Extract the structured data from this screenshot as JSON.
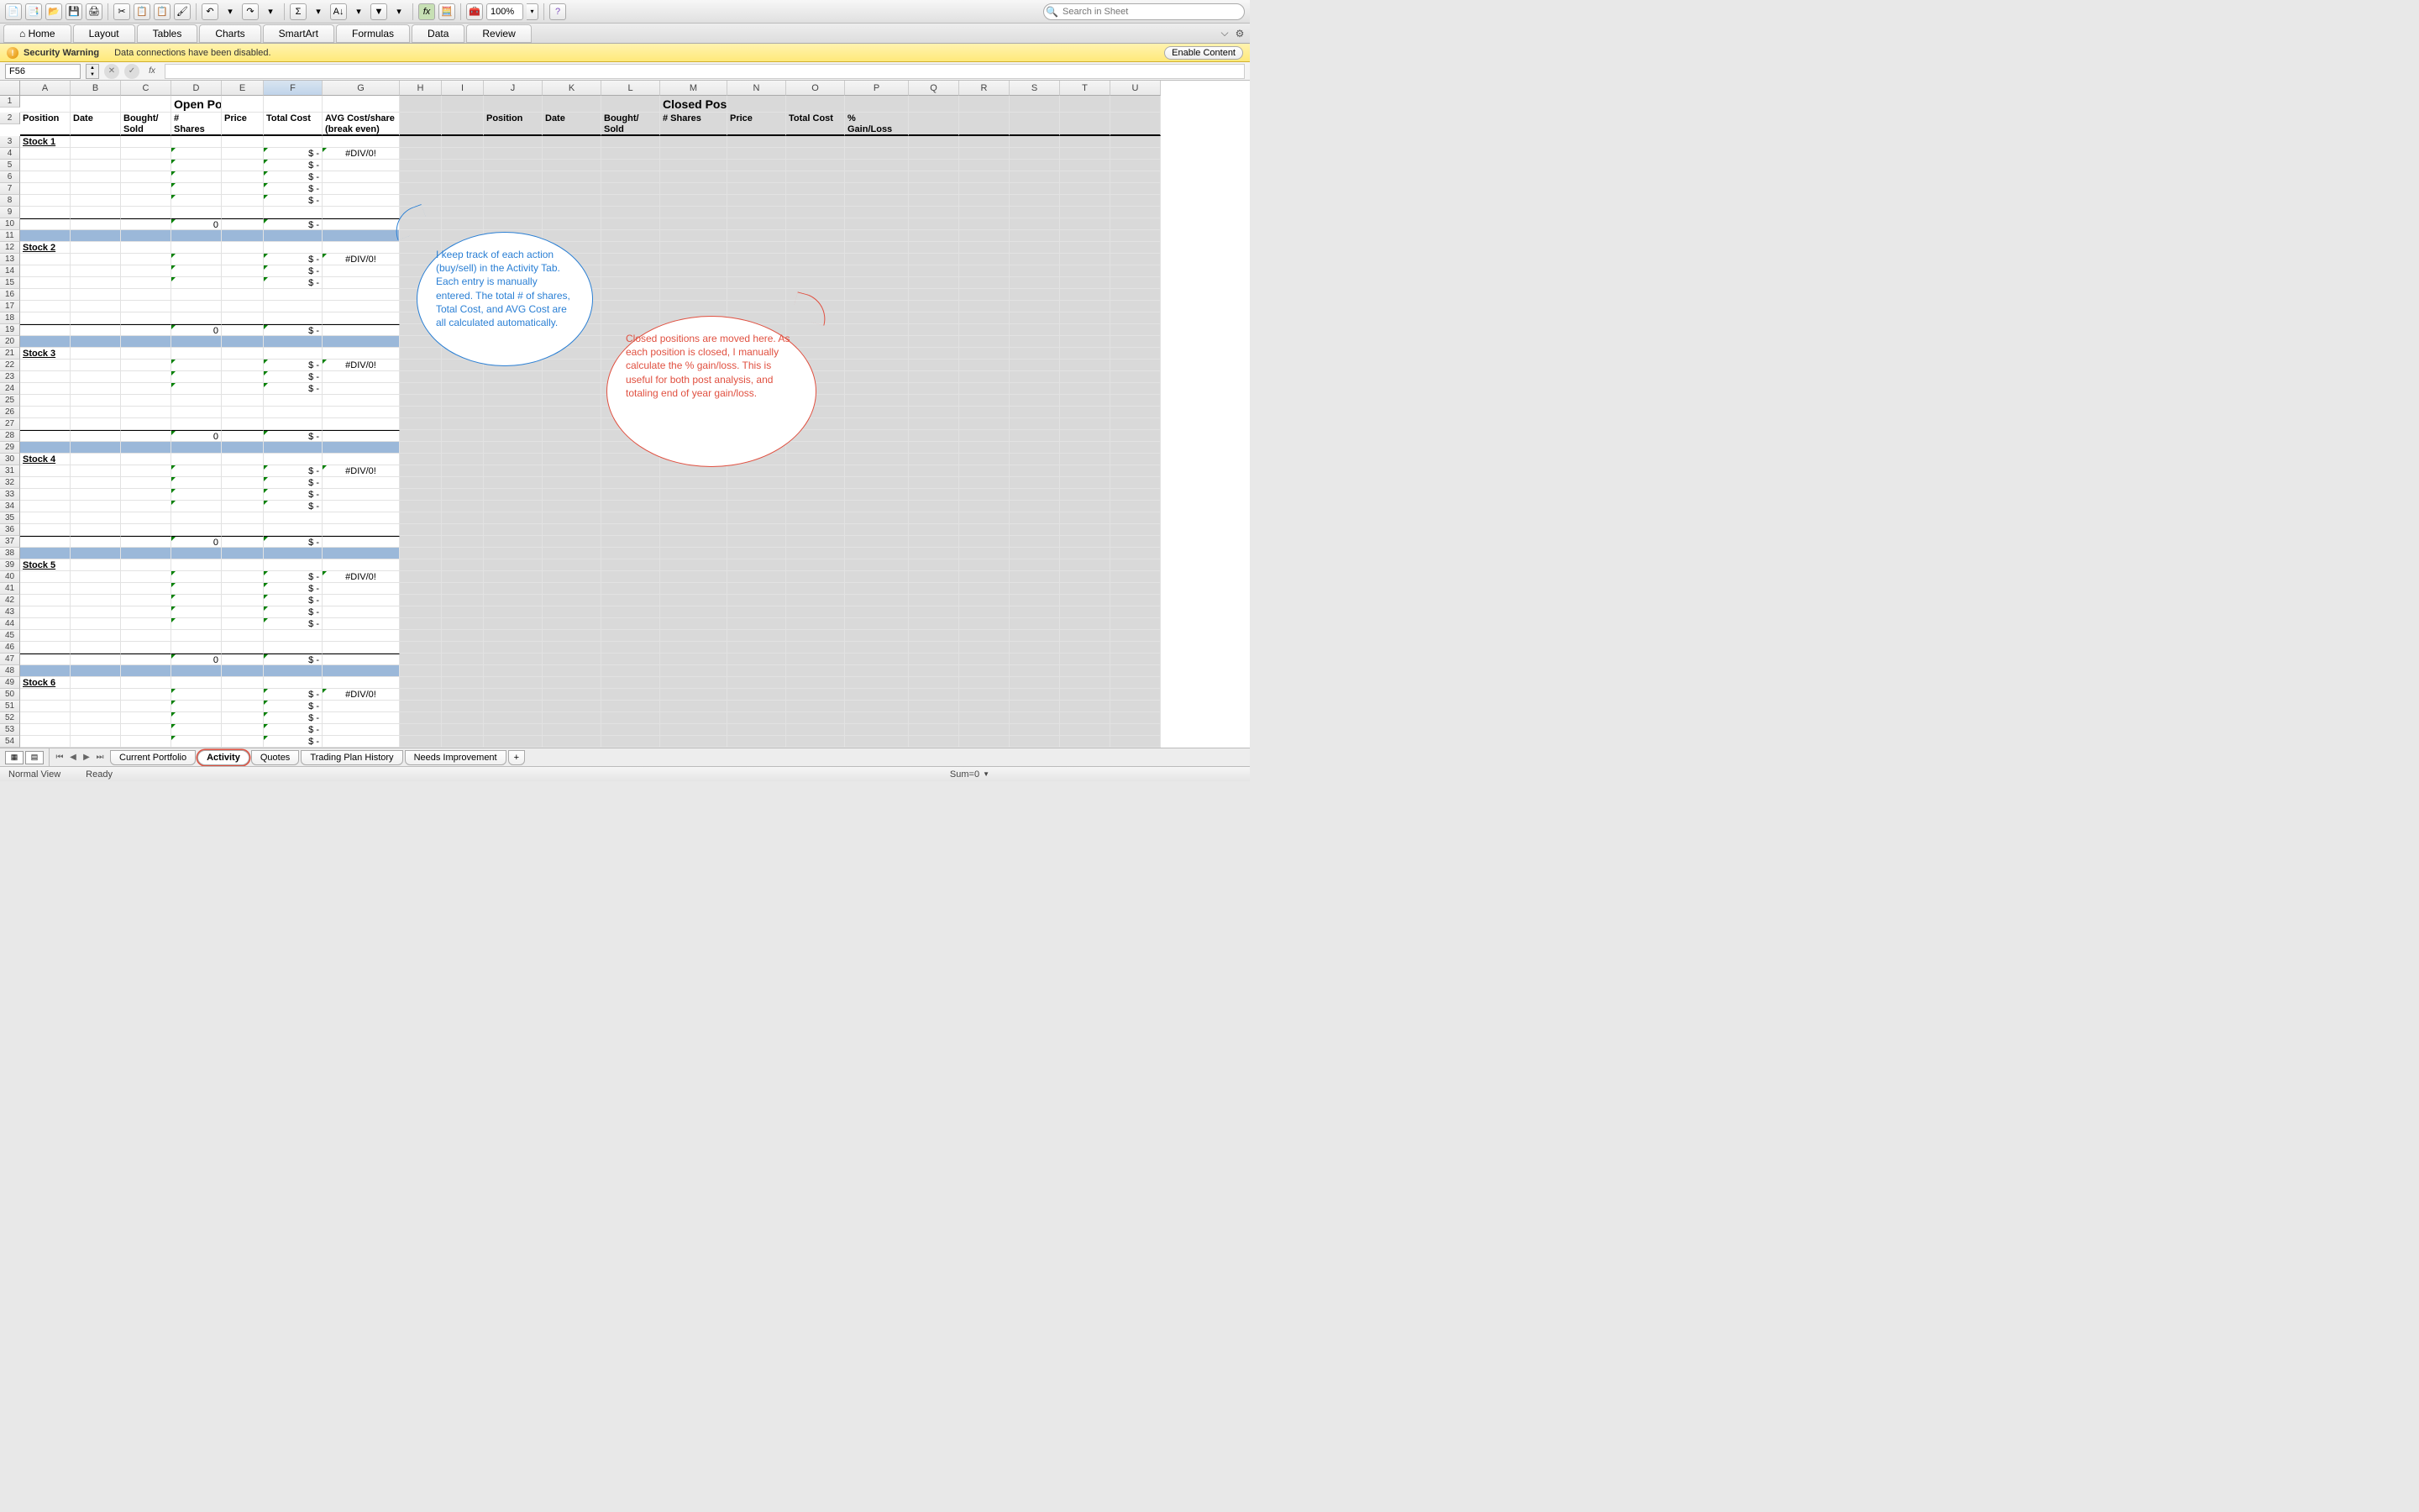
{
  "toolbar": {
    "zoom": "100%",
    "search_placeholder": "Search in Sheet"
  },
  "ribbon": {
    "tabs": [
      "Home",
      "Layout",
      "Tables",
      "Charts",
      "SmartArt",
      "Formulas",
      "Data",
      "Review"
    ]
  },
  "security": {
    "title": "Security Warning",
    "message": "Data connections have been disabled.",
    "button": "Enable Content"
  },
  "formula_bar": {
    "namebox": "F56",
    "fx_label": "fx"
  },
  "columns": [
    "A",
    "B",
    "C",
    "D",
    "E",
    "F",
    "G",
    "H",
    "I",
    "J",
    "K",
    "L",
    "M",
    "N",
    "O",
    "P",
    "Q",
    "R",
    "S",
    "T",
    "U"
  ],
  "titles": {
    "open": "Open Positions",
    "closed": "Closed Positions"
  },
  "headers_open": {
    "position": "Position",
    "date": "Date",
    "bought_sold": "Bought/\nSold",
    "shares": "#\nShares",
    "price": "Price",
    "total_cost": "Total Cost",
    "avg": "AVG Cost/share (break even)"
  },
  "headers_closed": {
    "position": "Position",
    "date": "Date",
    "bought_sold": "Bought/\nSold",
    "shares": "# Shares",
    "price": "Price",
    "total_cost": "Total Cost",
    "pct": "%\nGain/Loss"
  },
  "stocks": [
    "Stock 1",
    "Stock 2",
    "Stock 3",
    "Stock 4",
    "Stock 5",
    "Stock 6"
  ],
  "vals": {
    "zero": "0",
    "dollar": "$",
    "dash": "-",
    "div0": "#DIV/0!"
  },
  "bubble_blue": "I keep track of each action (buy/sell) in the Activity Tab. Each entry is manually entered. The total # of shares, Total Cost, and AVG Cost are all calculated automatically.",
  "bubble_red": "Closed positions are moved here.  As each position is closed, I manually calculate the % gain/loss.  This is useful for both post analysis, and totaling end of year gain/loss.",
  "sheet_tabs": [
    "Current Portfolio",
    "Activity",
    "Quotes",
    "Trading Plan History",
    "Needs Improvement"
  ],
  "active_tab": "Activity",
  "status": {
    "view": "Normal View",
    "ready": "Ready",
    "sum": "Sum=0"
  },
  "selected_cell": "F56"
}
